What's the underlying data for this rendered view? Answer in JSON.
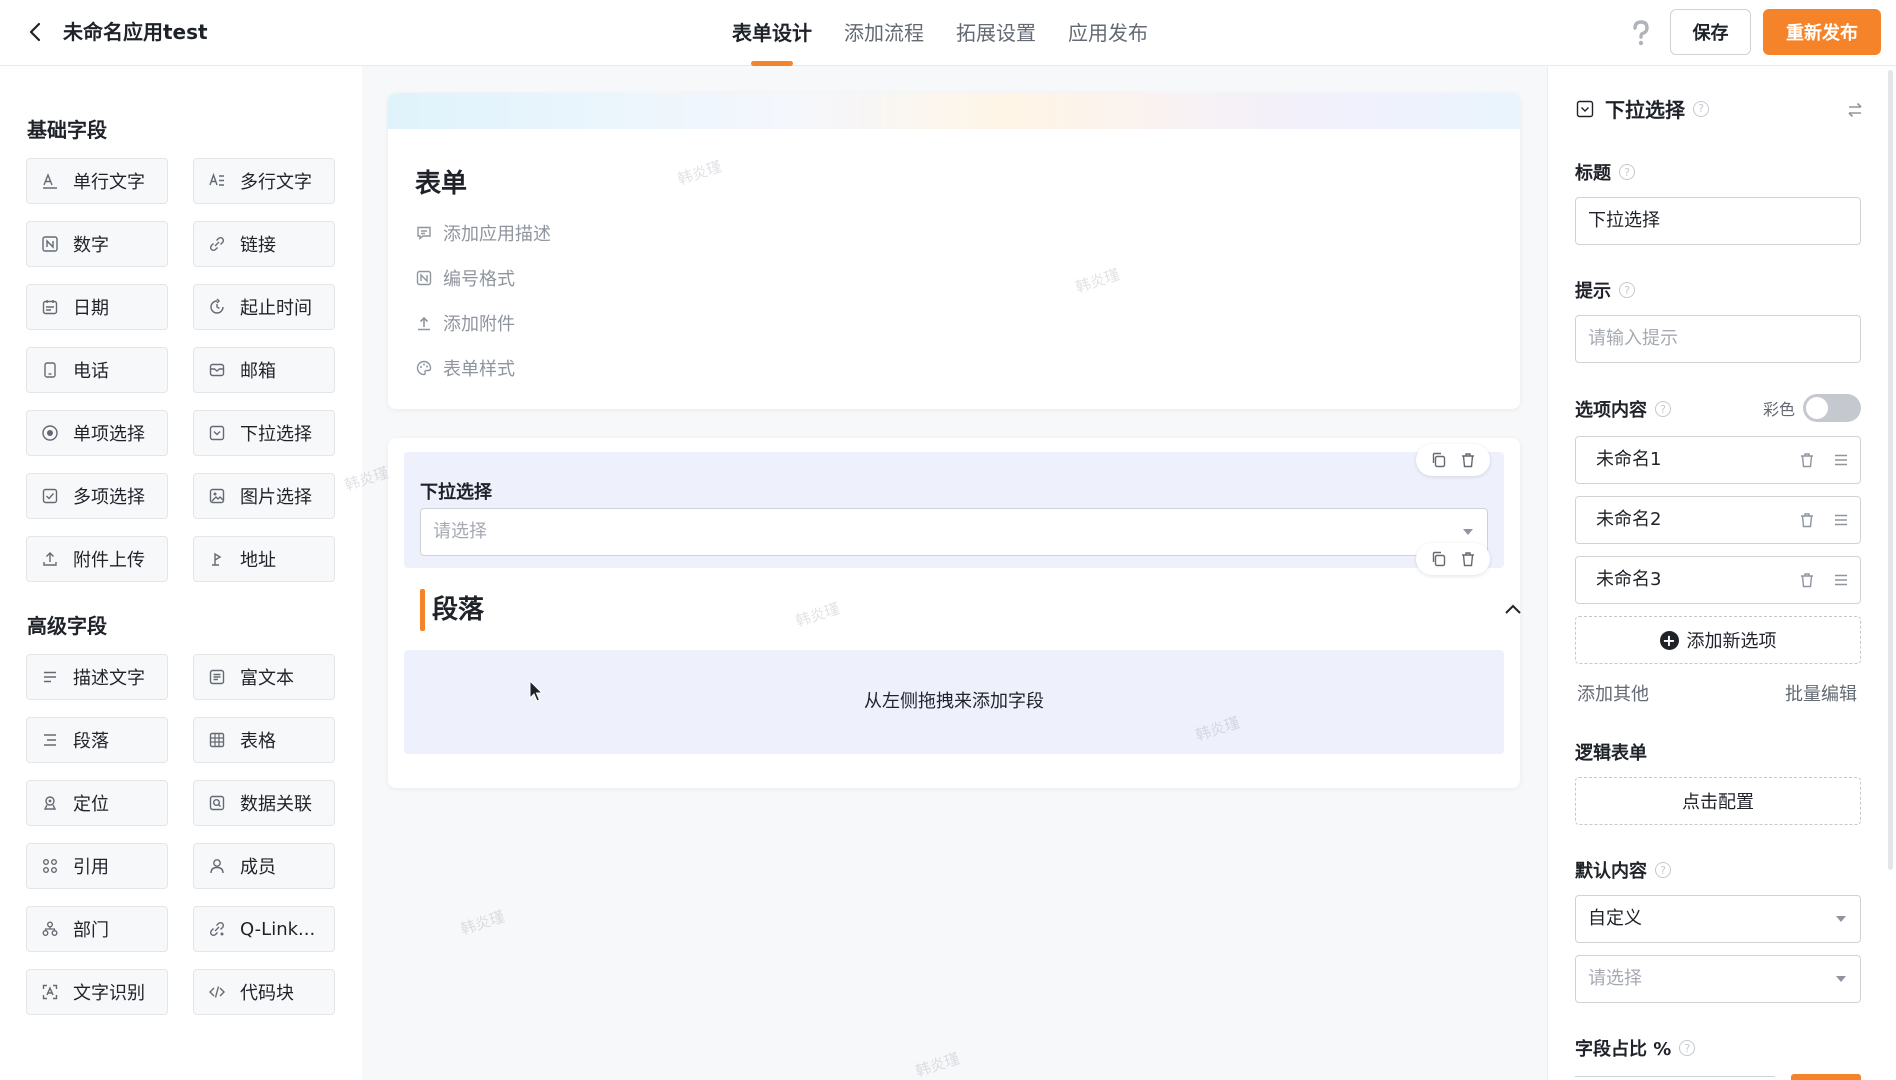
{
  "header": {
    "app_title": "未命名应用test",
    "tabs": [
      "表单设计",
      "添加流程",
      "拓展设置",
      "应用发布"
    ],
    "active_tab": 0,
    "save_label": "保存",
    "publish_label": "重新发布"
  },
  "palette": {
    "basic_title": "基础字段",
    "advanced_title": "高级字段",
    "basic_fields": [
      {
        "label": "单行文字",
        "icon": "single-line-text-icon"
      },
      {
        "label": "多行文字",
        "icon": "multi-line-text-icon"
      },
      {
        "label": "数字",
        "icon": "number-icon"
      },
      {
        "label": "链接",
        "icon": "link-icon"
      },
      {
        "label": "日期",
        "icon": "calendar-icon"
      },
      {
        "label": "起止时间",
        "icon": "time-range-icon"
      },
      {
        "label": "电话",
        "icon": "phone-icon"
      },
      {
        "label": "邮箱",
        "icon": "mail-icon"
      },
      {
        "label": "单项选择",
        "icon": "radio-icon"
      },
      {
        "label": "下拉选择",
        "icon": "dropdown-icon"
      },
      {
        "label": "多项选择",
        "icon": "checkbox-icon"
      },
      {
        "label": "图片选择",
        "icon": "image-icon"
      },
      {
        "label": "附件上传",
        "icon": "upload-icon"
      },
      {
        "label": "地址",
        "icon": "location-pin-icon"
      }
    ],
    "advanced_fields": [
      {
        "label": "描述文字",
        "icon": "description-icon"
      },
      {
        "label": "富文本",
        "icon": "rich-text-icon"
      },
      {
        "label": "段落",
        "icon": "paragraph-icon"
      },
      {
        "label": "表格",
        "icon": "table-icon"
      },
      {
        "label": "定位",
        "icon": "locate-icon"
      },
      {
        "label": "数据关联",
        "icon": "data-link-icon"
      },
      {
        "label": "引用",
        "icon": "reference-icon"
      },
      {
        "label": "成员",
        "icon": "member-icon"
      },
      {
        "label": "部门",
        "icon": "department-icon"
      },
      {
        "label": "Q-Link...",
        "icon": "qlink-icon"
      },
      {
        "label": "文字识别",
        "icon": "ocr-icon"
      },
      {
        "label": "代码块",
        "icon": "code-icon"
      }
    ]
  },
  "canvas": {
    "form_title": "表单",
    "form_options": [
      "添加应用描述",
      "编号格式",
      "添加附件",
      "表单样式"
    ],
    "dropdown_label": "下拉选择",
    "dropdown_placeholder": "请选择",
    "paragraph_title": "段落",
    "drop_hint": "从左侧拖拽来添加字段",
    "watermark": "韩炎瑾"
  },
  "panel": {
    "title": "下拉选择",
    "title_label": "标题",
    "title_value": "下拉选择",
    "hint_label": "提示",
    "hint_placeholder": "请输入提示",
    "options_label": "选项内容",
    "color_label": "彩色",
    "color_enabled": false,
    "options": [
      "未命名1",
      "未命名2",
      "未命名3"
    ],
    "add_option_label": "添加新选项",
    "add_other_label": "添加其他",
    "batch_edit_label": "批量编辑",
    "logic_label": "逻辑表单",
    "logic_btn_label": "点击配置",
    "default_label": "默认内容",
    "default_mode": "自定义",
    "default_placeholder": "请选择",
    "width_label": "字段占比 %"
  }
}
